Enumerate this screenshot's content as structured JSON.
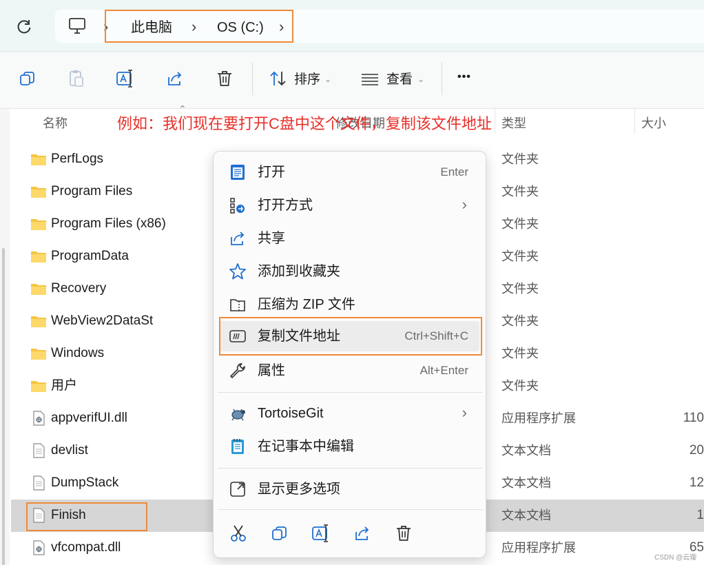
{
  "address": {
    "crumbs": [
      "此电脑",
      "OS (C:)"
    ]
  },
  "toolbar": {
    "sort_label": "排序",
    "view_label": "查看",
    "more_label": "•••"
  },
  "columns": {
    "name": "名称",
    "date": "修改日期",
    "type": "类型",
    "size": "大小"
  },
  "annotation": "例如：我们现在要打开C盘中这个文件，复制该文件地址",
  "files": [
    {
      "name": "PerfLogs",
      "type": "文件夹",
      "size": "",
      "icon": "folder-icon"
    },
    {
      "name": "Program Files",
      "type": "文件夹",
      "size": "",
      "icon": "folder-icon"
    },
    {
      "name": "Program Files (x86)",
      "type": "文件夹",
      "size": "",
      "icon": "folder-icon"
    },
    {
      "name": "ProgramData",
      "type": "文件夹",
      "size": "",
      "icon": "folder-icon"
    },
    {
      "name": "Recovery",
      "type": "文件夹",
      "size": "",
      "icon": "folder-icon"
    },
    {
      "name": "WebView2DataSt",
      "type": "文件夹",
      "size": "",
      "icon": "folder-icon"
    },
    {
      "name": "Windows",
      "type": "文件夹",
      "size": "",
      "icon": "folder-icon"
    },
    {
      "name": "用户",
      "type": "文件夹",
      "size": "",
      "icon": "folder-icon"
    },
    {
      "name": "appverifUI.dll",
      "type": "应用程序扩展",
      "size": "110",
      "icon": "dll-file-icon"
    },
    {
      "name": "devlist",
      "type": "文本文档",
      "size": "20",
      "icon": "text-file-icon"
    },
    {
      "name": "DumpStack",
      "type": "文本文档",
      "size": "12",
      "icon": "text-file-icon"
    },
    {
      "name": "Finish",
      "type": "文本文档",
      "size": "1",
      "icon": "text-file-icon"
    },
    {
      "name": "vfcompat.dll",
      "type": "应用程序扩展",
      "size": "65",
      "icon": "dll-file-icon"
    }
  ],
  "context_menu": {
    "items": [
      {
        "label": "打开",
        "shortcut": "Enter",
        "icon": "notepad-icon"
      },
      {
        "label": "打开方式",
        "shortcut": "",
        "icon": "open-with-icon",
        "submenu": true
      },
      {
        "label": "共享",
        "shortcut": "",
        "icon": "share-icon"
      },
      {
        "label": "添加到收藏夹",
        "shortcut": "",
        "icon": "star-icon"
      },
      {
        "label": "压缩为 ZIP 文件",
        "shortcut": "",
        "icon": "zip-folder-icon"
      },
      {
        "label": "复制文件地址",
        "shortcut": "Ctrl+Shift+C",
        "icon": "copy-path-icon"
      },
      {
        "label": "属性",
        "shortcut": "Alt+Enter",
        "icon": "wrench-icon"
      },
      {
        "label": "TortoiseGit",
        "shortcut": "",
        "icon": "tortoise-icon",
        "submenu": true
      },
      {
        "label": "在记事本中编辑",
        "shortcut": "",
        "icon": "notepad-icon"
      },
      {
        "label": "显示更多选项",
        "shortcut": "",
        "icon": "more-options-icon"
      }
    ],
    "arrow": "›"
  },
  "watermark": "CSDN @云璇",
  "colors": {
    "highlight_box": "#ee8a3a",
    "annotation_text": "#e8302a",
    "folder": "#f5c542",
    "accent_blue": "#1f6fd0"
  }
}
